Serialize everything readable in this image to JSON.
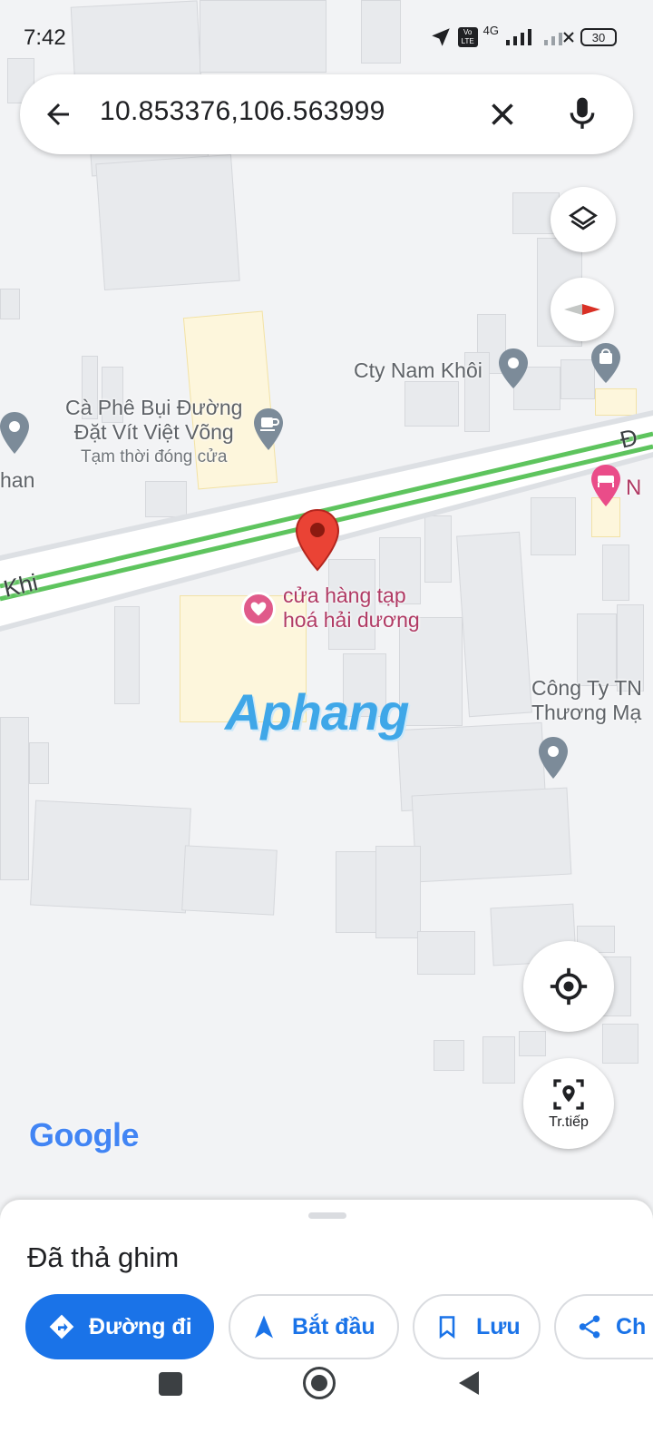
{
  "status_bar": {
    "time": "7:42",
    "network": "4G",
    "battery": "30"
  },
  "search": {
    "query": "10.853376,106.563999"
  },
  "map": {
    "places": {
      "cty_nam_khoi": "Cty Nam Khôi",
      "cafe_line1": "Cà Phê Bụi Đường",
      "cafe_line2": "Đặt Vít Việt Võng",
      "cafe_status": "Tạm thời đóng cửa",
      "left_partial": "han",
      "store_line1": "cửa hàng tạp",
      "store_line2": "hoá hải dương",
      "company_line1": "Công Ty TN",
      "company_line2": "Thương Mạ",
      "road_left": "Khi",
      "road_right": "Đ",
      "hotel_partial": "N"
    },
    "watermark": "Aphang",
    "google_logo": "Google",
    "next_button_label": "Tr.tiếp"
  },
  "sheet": {
    "title": "Đã thả ghim",
    "actions": [
      {
        "label": "Đường đi"
      },
      {
        "label": "Bắt đầu"
      },
      {
        "label": "Lưu"
      },
      {
        "label": "Ch"
      }
    ]
  },
  "colors": {
    "accent": "#1a73e8",
    "pin": "#d93025",
    "road_stripe": "#5ec45e"
  }
}
